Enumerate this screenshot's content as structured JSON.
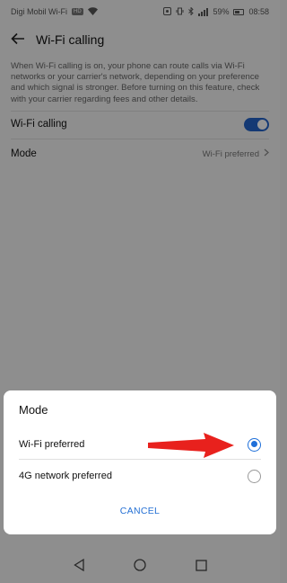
{
  "statusbar": {
    "carrier": "Digi Mobil Wi-Fi",
    "hd_badge": "HD",
    "battery": "59%",
    "time": "08:58"
  },
  "appbar": {
    "title": "Wi-Fi calling",
    "back_icon": "back-arrow-icon"
  },
  "description": "When Wi-Fi calling is on, your phone can route calls via Wi-Fi networks or your carrier's network, depending on your preference and which signal is stronger. Before turning on this feature, check with your carrier regarding fees and other details.",
  "settings": {
    "wifi_calling_label": "Wi-Fi calling",
    "wifi_calling_on": true,
    "mode_label": "Mode",
    "mode_value": "Wi-Fi preferred"
  },
  "dialog": {
    "title": "Mode",
    "options": [
      {
        "label": "Wi-Fi preferred",
        "selected": true
      },
      {
        "label": "4G network preferred",
        "selected": false
      }
    ],
    "cancel_label": "CANCEL"
  },
  "colors": {
    "accent": "#1e6fd9",
    "arrow": "#e8211d"
  }
}
